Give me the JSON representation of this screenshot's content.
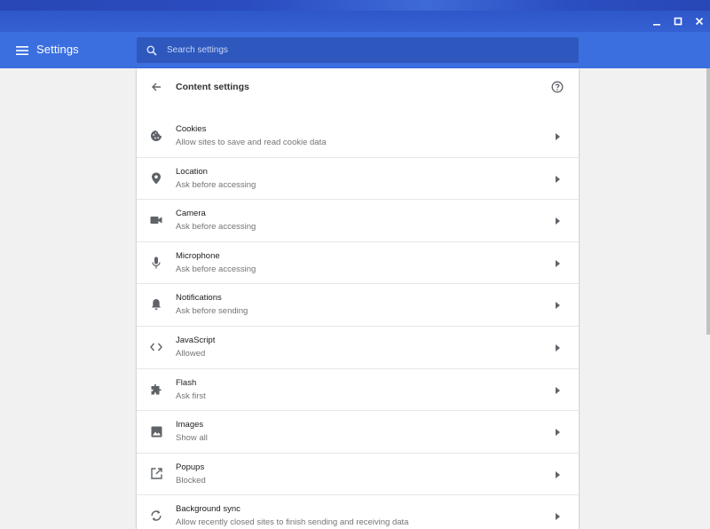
{
  "app": {
    "title": "Settings"
  },
  "search": {
    "placeholder": "Search settings"
  },
  "page": {
    "title": "Content settings"
  },
  "items": [
    {
      "label": "Cookies",
      "sub": "Allow sites to save and read cookie data",
      "icon": "cookie-icon"
    },
    {
      "label": "Location",
      "sub": "Ask before accessing",
      "icon": "location-pin-icon"
    },
    {
      "label": "Camera",
      "sub": "Ask before accessing",
      "icon": "camera-icon"
    },
    {
      "label": "Microphone",
      "sub": "Ask before accessing",
      "icon": "microphone-icon"
    },
    {
      "label": "Notifications",
      "sub": "Ask before sending",
      "icon": "bell-icon"
    },
    {
      "label": "JavaScript",
      "sub": "Allowed",
      "icon": "code-icon"
    },
    {
      "label": "Flash",
      "sub": "Ask first",
      "icon": "puzzle-piece-icon"
    },
    {
      "label": "Images",
      "sub": "Show all",
      "icon": "image-icon"
    },
    {
      "label": "Popups",
      "sub": "Blocked",
      "icon": "open-in-new-icon"
    },
    {
      "label": "Background sync",
      "sub": "Allow recently closed sites to finish sending and receiving data",
      "icon": "sync-icon"
    }
  ],
  "colors": {
    "appbar": "#3b6fe0",
    "search_bg": "#2e58bd",
    "icon": "#5f6368",
    "background": "#f1f1f1"
  }
}
